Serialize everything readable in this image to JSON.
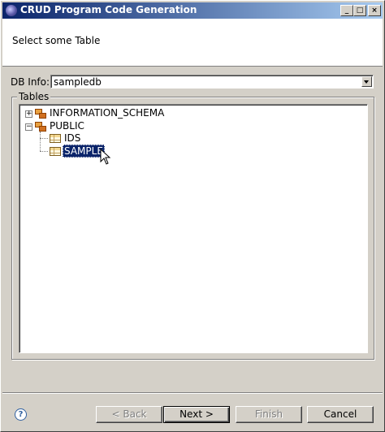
{
  "window": {
    "title": "CRUD Program Code Generation",
    "minimize": "_",
    "maximize": "□",
    "close": "×"
  },
  "header": {
    "message": "Select some Table"
  },
  "db_info": {
    "label": "DB Info:",
    "value": "sampledb"
  },
  "tables": {
    "label": "Tables",
    "nodes": [
      {
        "label": "INFORMATION_SCHEMA",
        "expander": "+"
      },
      {
        "label": "PUBLIC",
        "expander": "−",
        "children": [
          {
            "label": "IDS"
          },
          {
            "label": "SAMPLE",
            "selected": true
          }
        ]
      }
    ]
  },
  "buttons": {
    "help": "?",
    "back": "< Back",
    "next": "Next >",
    "finish": "Finish",
    "cancel": "Cancel"
  }
}
